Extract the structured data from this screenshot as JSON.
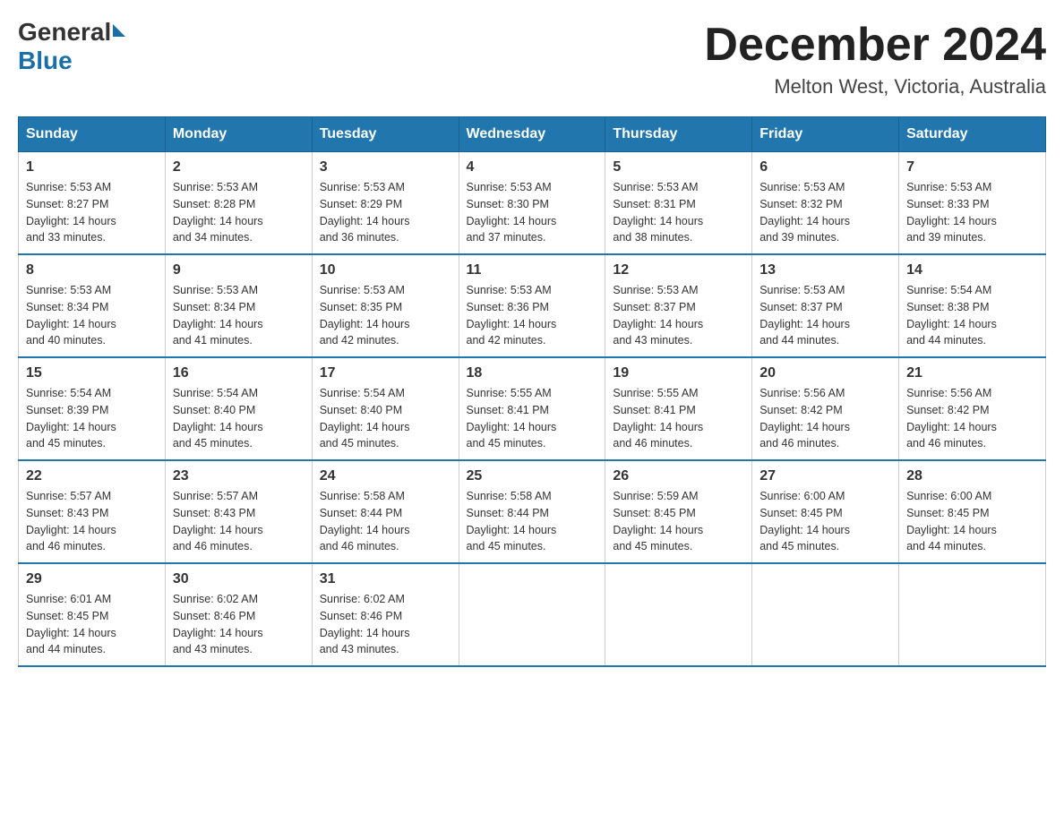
{
  "header": {
    "logo_general": "General",
    "logo_blue": "Blue",
    "month_title": "December 2024",
    "location": "Melton West, Victoria, Australia"
  },
  "weekdays": [
    "Sunday",
    "Monday",
    "Tuesday",
    "Wednesday",
    "Thursday",
    "Friday",
    "Saturday"
  ],
  "weeks": [
    [
      {
        "day": "1",
        "sunrise": "5:53 AM",
        "sunset": "8:27 PM",
        "daylight": "14 hours and 33 minutes."
      },
      {
        "day": "2",
        "sunrise": "5:53 AM",
        "sunset": "8:28 PM",
        "daylight": "14 hours and 34 minutes."
      },
      {
        "day": "3",
        "sunrise": "5:53 AM",
        "sunset": "8:29 PM",
        "daylight": "14 hours and 36 minutes."
      },
      {
        "day": "4",
        "sunrise": "5:53 AM",
        "sunset": "8:30 PM",
        "daylight": "14 hours and 37 minutes."
      },
      {
        "day": "5",
        "sunrise": "5:53 AM",
        "sunset": "8:31 PM",
        "daylight": "14 hours and 38 minutes."
      },
      {
        "day": "6",
        "sunrise": "5:53 AM",
        "sunset": "8:32 PM",
        "daylight": "14 hours and 39 minutes."
      },
      {
        "day": "7",
        "sunrise": "5:53 AM",
        "sunset": "8:33 PM",
        "daylight": "14 hours and 39 minutes."
      }
    ],
    [
      {
        "day": "8",
        "sunrise": "5:53 AM",
        "sunset": "8:34 PM",
        "daylight": "14 hours and 40 minutes."
      },
      {
        "day": "9",
        "sunrise": "5:53 AM",
        "sunset": "8:34 PM",
        "daylight": "14 hours and 41 minutes."
      },
      {
        "day": "10",
        "sunrise": "5:53 AM",
        "sunset": "8:35 PM",
        "daylight": "14 hours and 42 minutes."
      },
      {
        "day": "11",
        "sunrise": "5:53 AM",
        "sunset": "8:36 PM",
        "daylight": "14 hours and 42 minutes."
      },
      {
        "day": "12",
        "sunrise": "5:53 AM",
        "sunset": "8:37 PM",
        "daylight": "14 hours and 43 minutes."
      },
      {
        "day": "13",
        "sunrise": "5:53 AM",
        "sunset": "8:37 PM",
        "daylight": "14 hours and 44 minutes."
      },
      {
        "day": "14",
        "sunrise": "5:54 AM",
        "sunset": "8:38 PM",
        "daylight": "14 hours and 44 minutes."
      }
    ],
    [
      {
        "day": "15",
        "sunrise": "5:54 AM",
        "sunset": "8:39 PM",
        "daylight": "14 hours and 45 minutes."
      },
      {
        "day": "16",
        "sunrise": "5:54 AM",
        "sunset": "8:40 PM",
        "daylight": "14 hours and 45 minutes."
      },
      {
        "day": "17",
        "sunrise": "5:54 AM",
        "sunset": "8:40 PM",
        "daylight": "14 hours and 45 minutes."
      },
      {
        "day": "18",
        "sunrise": "5:55 AM",
        "sunset": "8:41 PM",
        "daylight": "14 hours and 45 minutes."
      },
      {
        "day": "19",
        "sunrise": "5:55 AM",
        "sunset": "8:41 PM",
        "daylight": "14 hours and 46 minutes."
      },
      {
        "day": "20",
        "sunrise": "5:56 AM",
        "sunset": "8:42 PM",
        "daylight": "14 hours and 46 minutes."
      },
      {
        "day": "21",
        "sunrise": "5:56 AM",
        "sunset": "8:42 PM",
        "daylight": "14 hours and 46 minutes."
      }
    ],
    [
      {
        "day": "22",
        "sunrise": "5:57 AM",
        "sunset": "8:43 PM",
        "daylight": "14 hours and 46 minutes."
      },
      {
        "day": "23",
        "sunrise": "5:57 AM",
        "sunset": "8:43 PM",
        "daylight": "14 hours and 46 minutes."
      },
      {
        "day": "24",
        "sunrise": "5:58 AM",
        "sunset": "8:44 PM",
        "daylight": "14 hours and 46 minutes."
      },
      {
        "day": "25",
        "sunrise": "5:58 AM",
        "sunset": "8:44 PM",
        "daylight": "14 hours and 45 minutes."
      },
      {
        "day": "26",
        "sunrise": "5:59 AM",
        "sunset": "8:45 PM",
        "daylight": "14 hours and 45 minutes."
      },
      {
        "day": "27",
        "sunrise": "6:00 AM",
        "sunset": "8:45 PM",
        "daylight": "14 hours and 45 minutes."
      },
      {
        "day": "28",
        "sunrise": "6:00 AM",
        "sunset": "8:45 PM",
        "daylight": "14 hours and 44 minutes."
      }
    ],
    [
      {
        "day": "29",
        "sunrise": "6:01 AM",
        "sunset": "8:45 PM",
        "daylight": "14 hours and 44 minutes."
      },
      {
        "day": "30",
        "sunrise": "6:02 AM",
        "sunset": "8:46 PM",
        "daylight": "14 hours and 43 minutes."
      },
      {
        "day": "31",
        "sunrise": "6:02 AM",
        "sunset": "8:46 PM",
        "daylight": "14 hours and 43 minutes."
      },
      null,
      null,
      null,
      null
    ]
  ],
  "labels": {
    "sunrise": "Sunrise:",
    "sunset": "Sunset:",
    "daylight": "Daylight:"
  }
}
